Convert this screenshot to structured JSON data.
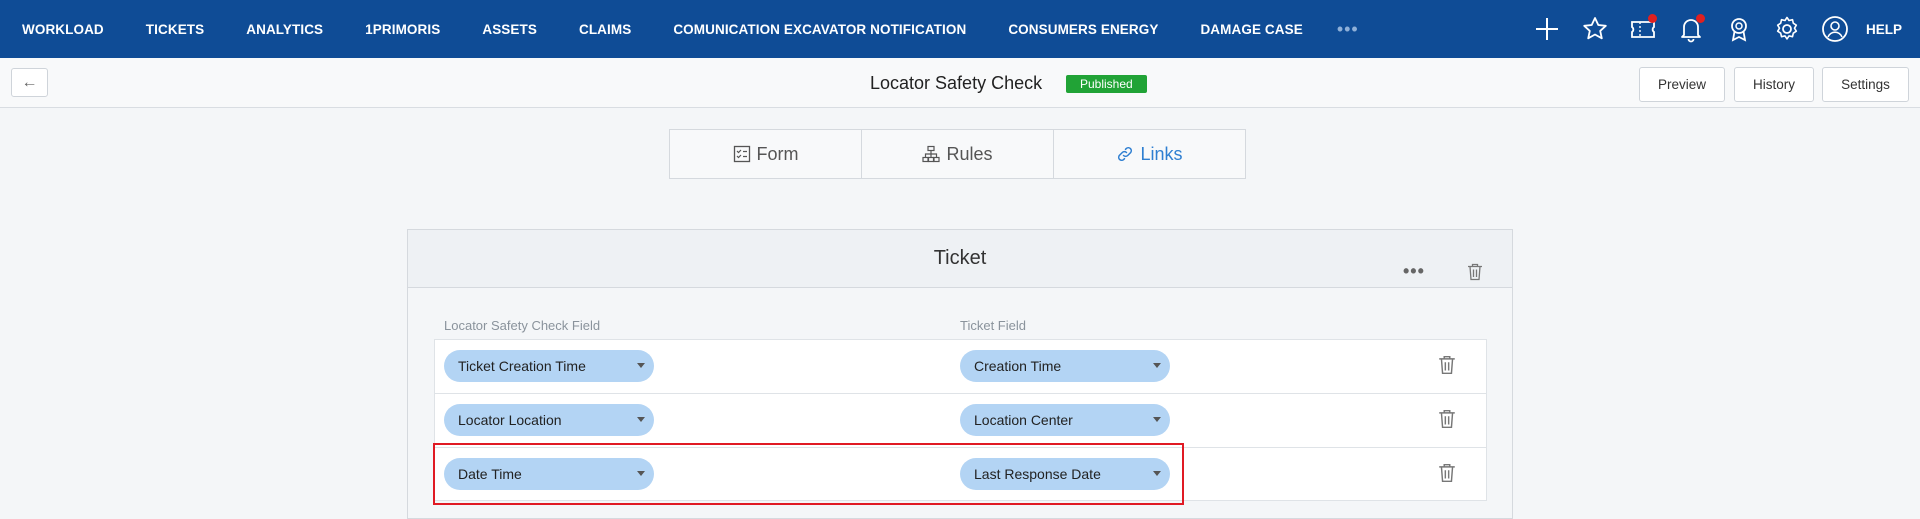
{
  "nav": {
    "items": [
      "WORKLOAD",
      "TICKETS",
      "ANALYTICS",
      "1PRIMORIS",
      "ASSETS",
      "CLAIMS",
      "COMUNICATION EXCAVATOR NOTIFICATION",
      "CONSUMERS ENERGY",
      "DAMAGE CASE"
    ],
    "more": "•••",
    "help": "HELP"
  },
  "header": {
    "back": "←",
    "title": "Locator Safety Check",
    "status": "Published",
    "preview": "Preview",
    "history": "History",
    "settings": "Settings"
  },
  "tabs": {
    "form": "Form",
    "rules": "Rules",
    "links": "Links",
    "active": "Links"
  },
  "card": {
    "title": "Ticket",
    "more": "•••",
    "left_col_label": "Locator Safety Check Field",
    "right_col_label": "Ticket Field",
    "rows": [
      {
        "left": "Ticket Creation Time",
        "right": "Creation Time"
      },
      {
        "left": "Locator Location",
        "right": "Location Center"
      },
      {
        "left": "Date Time",
        "right": "Last Response Date"
      }
    ]
  },
  "colors": {
    "nav_bg": "#0f4c96",
    "badge": "#21a336",
    "active_tab": "#2f7fd1",
    "pill": "#b3d4f4",
    "highlight": "#e01a24"
  }
}
